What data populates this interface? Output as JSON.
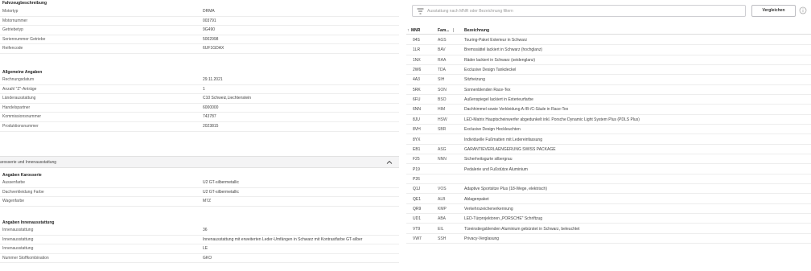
{
  "vehicle": {
    "title": "Fahrzeugbeschreibung",
    "rows": [
      {
        "label": "Motortyp",
        "value": "DRMA"
      },
      {
        "label": "Motornummer",
        "value": "003791"
      },
      {
        "label": "Getriebetyp",
        "value": "9G490"
      },
      {
        "label": "Seriennummer Getriebe",
        "value": "5002998"
      },
      {
        "label": "Reifencode",
        "value": "6UF1GDAX"
      }
    ]
  },
  "general": {
    "title": "Allgemeine Angaben",
    "rows": [
      {
        "label": "Rechnungsdatum",
        "value": "29.11.2021"
      },
      {
        "label": "Anzahl \"Z\"-Anträge",
        "value": "1"
      },
      {
        "label": "Länderausstattung",
        "value": "C10 Schweiz,Liechtenstein"
      },
      {
        "label": "Handelspartner",
        "value": "6000000"
      },
      {
        "label": "Kommissionsnummer",
        "value": "743787"
      },
      {
        "label": "Produktionsnummer",
        "value": "2023815"
      }
    ]
  },
  "accordion": {
    "title": "arosserie und Innenausstattung"
  },
  "body_specs": {
    "title": "Angaben Karosserie",
    "rows": [
      {
        "label": "Aussenfarbe",
        "value": "U2 GT-silbermetallic"
      },
      {
        "label": "Dachverkleidung Farbe",
        "value": "U2 GT-silbermetallic"
      },
      {
        "label": "Wagenfarbe",
        "value": "M7Z"
      }
    ]
  },
  "interior_specs": {
    "title": "Angaben Innenausstattung",
    "rows": [
      {
        "label": "Innenausstattung",
        "value": "36"
      },
      {
        "label": "Innenausstattung",
        "value": "Innenausstattung mit erweiterten Leder-Umfängen in Schwarz mit Kontrastfarbe GT-silber"
      },
      {
        "label": "Innenausstattung",
        "value": "LE"
      },
      {
        "label": "Nummer Stoffkombination",
        "value": "GKO"
      }
    ]
  },
  "equipment": {
    "search_placeholder": "Ausstattung nach MNR oder Bezeichnung filtern",
    "compare_label": "Vergleichen",
    "columns": {
      "mnr": "MNR",
      "fam": "Fam...",
      "desc": "Bezeichnung"
    },
    "rows": [
      {
        "mnr": "04S",
        "fam": "AGS",
        "desc": "Touring-Paket Exterieur in Schwarz"
      },
      {
        "mnr": "1LR",
        "fam": "BAV",
        "desc": "Bremssättel lackiert in Schwarz (hochglanz)"
      },
      {
        "mnr": "1NX",
        "fam": "RAA",
        "desc": "Räder lackiert in Schwarz (seidenglanz)"
      },
      {
        "mnr": "2W6",
        "fam": "TDA",
        "desc": "Exclusive Design Tankdeckel"
      },
      {
        "mnr": "4A3",
        "fam": "SIH",
        "desc": "Sitzheizung"
      },
      {
        "mnr": "5RK",
        "fam": "SON",
        "desc": "Sonnenblenden Race-Tex"
      },
      {
        "mnr": "6FU",
        "fam": "BSO",
        "desc": "Außenspiegel lackiert in Exterieurfarbe"
      },
      {
        "mnr": "6NN",
        "fam": "HIM",
        "desc": "Dachhimmel sowie Verkleidung A-/B-/C-Säule in Race-Tex"
      },
      {
        "mnr": "8JU",
        "fam": "HSW",
        "desc": "LED-Matrix Hauptscheinwerfer abgedunkelt inkl. Porsche Dynamic Light System Plus (PDLS Plus)"
      },
      {
        "mnr": "8VH",
        "fam": "SBR",
        "desc": "Exclusive Design Heckleuchten"
      },
      {
        "mnr": "8YX",
        "fam": "",
        "desc": "Individuelle Fußmatten mit Ledereinfassung"
      },
      {
        "mnr": "EB1",
        "fam": "ASG",
        "desc": "GARANTIEVERLAENGERUNG SWISS PACKAGE"
      },
      {
        "mnr": "F25",
        "fam": "NNN",
        "desc": "Sicherheitsgurte silbergrau"
      },
      {
        "mnr": "P19",
        "fam": "",
        "desc": "Pedalerie und Fußstütze Aluminium"
      },
      {
        "mnr": "P26",
        "fam": "",
        "desc": ""
      },
      {
        "mnr": "Q1J",
        "fam": "VOS",
        "desc": "Adaptive Sportsitze Plus (18-Wege, elektrisch)"
      },
      {
        "mnr": "QE1",
        "fam": "ALB",
        "desc": "Ablagenpaket"
      },
      {
        "mnr": "QR9",
        "fam": "KMP",
        "desc": "Verkehrszeichenerkennung"
      },
      {
        "mnr": "UD1",
        "fam": "ABA",
        "desc": "LED-Türprojektoren „PORSCHE\" Schriftzug"
      },
      {
        "mnr": "VT9",
        "fam": "EIL",
        "desc": "Türeinstiegsblenden Aluminium gebürstet in Schwarz, beleuchtet"
      },
      {
        "mnr": "VW7",
        "fam": "SSH",
        "desc": "Privacy-Verglasung"
      }
    ]
  }
}
